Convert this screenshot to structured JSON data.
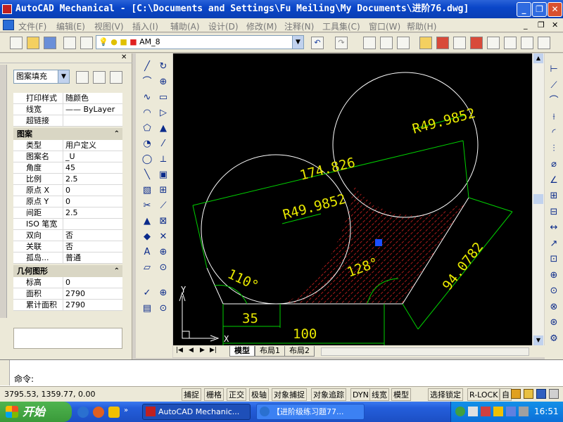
{
  "window": {
    "title": "AutoCAD Mechanical - [C:\\Documents and Settings\\Fu Meiling\\My Documents\\进阶76.dwg]",
    "buttons": [
      "_",
      "❐",
      "✕"
    ]
  },
  "menu": {
    "items": [
      "文件(F)",
      "编辑(E)",
      "视图(V)",
      "插入(I)",
      "辅助(A)",
      "设计(D)",
      "修改(M)",
      "注释(N)",
      "工具集(C)",
      "窗口(W)",
      "帮助(H)"
    ]
  },
  "layer_toolbar": {
    "layer_name": "AM_8"
  },
  "properties": {
    "object_type": "图案填充",
    "general": [
      {
        "k": "打印样式",
        "v": "随颜色"
      },
      {
        "k": "线宽",
        "v": "—— ByLayer"
      },
      {
        "k": "超链接",
        "v": ""
      }
    ],
    "pattern_header": "图案",
    "pattern": [
      {
        "k": "类型",
        "v": "用户定义"
      },
      {
        "k": "图案名",
        "v": "_U"
      },
      {
        "k": "角度",
        "v": "45"
      },
      {
        "k": "比例",
        "v": "2.5"
      },
      {
        "k": "原点 X",
        "v": "0"
      },
      {
        "k": "原点 Y",
        "v": "0"
      },
      {
        "k": "间距",
        "v": "2.5"
      },
      {
        "k": "ISO 笔宽",
        "v": ""
      },
      {
        "k": "双向",
        "v": "否"
      },
      {
        "k": "关联",
        "v": "否"
      },
      {
        "k": "孤岛...",
        "v": "普通"
      }
    ],
    "geometry_header": "几何图形",
    "geometry": [
      {
        "k": "标高",
        "v": "0"
      },
      {
        "k": "面积",
        "v": "2790"
      },
      {
        "k": "累计面积",
        "v": "2790"
      }
    ]
  },
  "drawing": {
    "dims": {
      "r_top": "R49.9852",
      "r_left": "R49.9852",
      "aligned_long": "174.826",
      "diag": "94.0782",
      "bottom_short": "35",
      "bottom_long": "100",
      "angle_left": "110°",
      "angle_right": "128°"
    },
    "ucs_y": "Y",
    "ucs_x": "X",
    "colors": {
      "background": "#000000",
      "geometry": "#ffffff",
      "dimension": "#e8e800",
      "extension": "#00d000",
      "hatch": "#d02020",
      "grip": "#1a4fff"
    }
  },
  "layout_tabs": [
    "模型",
    "布局1",
    "布局2"
  ],
  "command": {
    "prompt": "命令:"
  },
  "status": {
    "coords": "3795.53, 1359.77, 0.00",
    "toggles": [
      "捕捉",
      "栅格",
      "正交",
      "极轴",
      "对象捕捉",
      "对象追踪",
      "DYN",
      "线宽",
      "模型"
    ],
    "right": [
      "选择锁定",
      "R-LOCK",
      "自"
    ]
  },
  "taskbar": {
    "start": "开始",
    "tasks": [
      "AutoCAD Mechanic...",
      "【进阶级练习题77..."
    ],
    "clock": "16:51"
  }
}
